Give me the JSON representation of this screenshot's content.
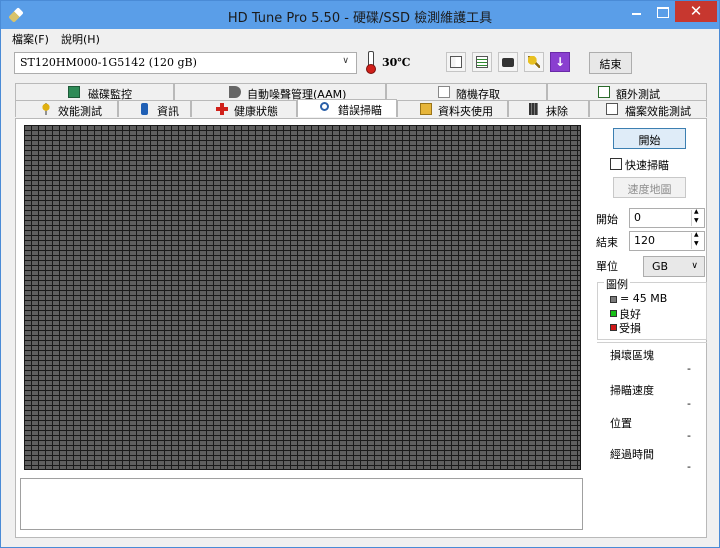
{
  "window": {
    "title": "HD Tune Pro 5.50 - 硬碟/SSD 檢測維護工具",
    "close_glyph": "✕"
  },
  "menu": {
    "file": "檔案(F)",
    "help": "說明(H)"
  },
  "toolbar": {
    "drive": "ST120HM000-1G5142 (120 gB)",
    "temperature": "30℃",
    "exit": "結束",
    "icons": [
      "copy-info-icon",
      "copy-all-icon",
      "screenshot-camera-icon",
      "options-wrench-icon",
      "save-download-icon"
    ]
  },
  "tabs": {
    "top": [
      {
        "label": "磁碟監控",
        "icon": "disk-monitor-icon"
      },
      {
        "label": "自動噪聲管理(AAM)",
        "icon": "speaker-icon"
      },
      {
        "label": "隨機存取",
        "icon": "random-access-icon"
      },
      {
        "label": "額外測試",
        "icon": "extra-tests-icon"
      }
    ],
    "bottom": [
      {
        "label": "效能測試",
        "icon": "benchmark-icon"
      },
      {
        "label": "資訊",
        "icon": "info-icon"
      },
      {
        "label": "健康狀態",
        "icon": "health-cross-icon"
      },
      {
        "label": "錯誤掃瞄",
        "icon": "magnifier-icon"
      },
      {
        "label": "資料夾使用",
        "icon": "folder-icon"
      },
      {
        "label": "抹除",
        "icon": "trash-icon"
      },
      {
        "label": "檔案效能測試",
        "icon": "file-benchmark-icon"
      }
    ],
    "active": "錯誤掃瞄"
  },
  "scan": {
    "start_button": "開始",
    "quick_scan": "快速掃瞄",
    "quick_scan_checked": false,
    "speed_map": "速度地圖",
    "start_label": "開始",
    "start_value": "0",
    "end_label": "結束",
    "end_value": "120",
    "unit_label": "單位",
    "unit_value": "GB"
  },
  "legend": {
    "title": "圖例",
    "block_size": "= 45 MB",
    "ok": "良好",
    "damaged": "受損",
    "colors": {
      "block": "#7a7a7a",
      "ok": "#18c018",
      "damaged": "#d01818"
    }
  },
  "stats": {
    "damaged_blocks_label": "損壞區塊",
    "damaged_blocks_value": "-",
    "scan_speed_label": "掃瞄速度",
    "scan_speed_value": "-",
    "position_label": "位置",
    "position_value": "-",
    "elapsed_label": "經過時間",
    "elapsed_value": "-"
  }
}
